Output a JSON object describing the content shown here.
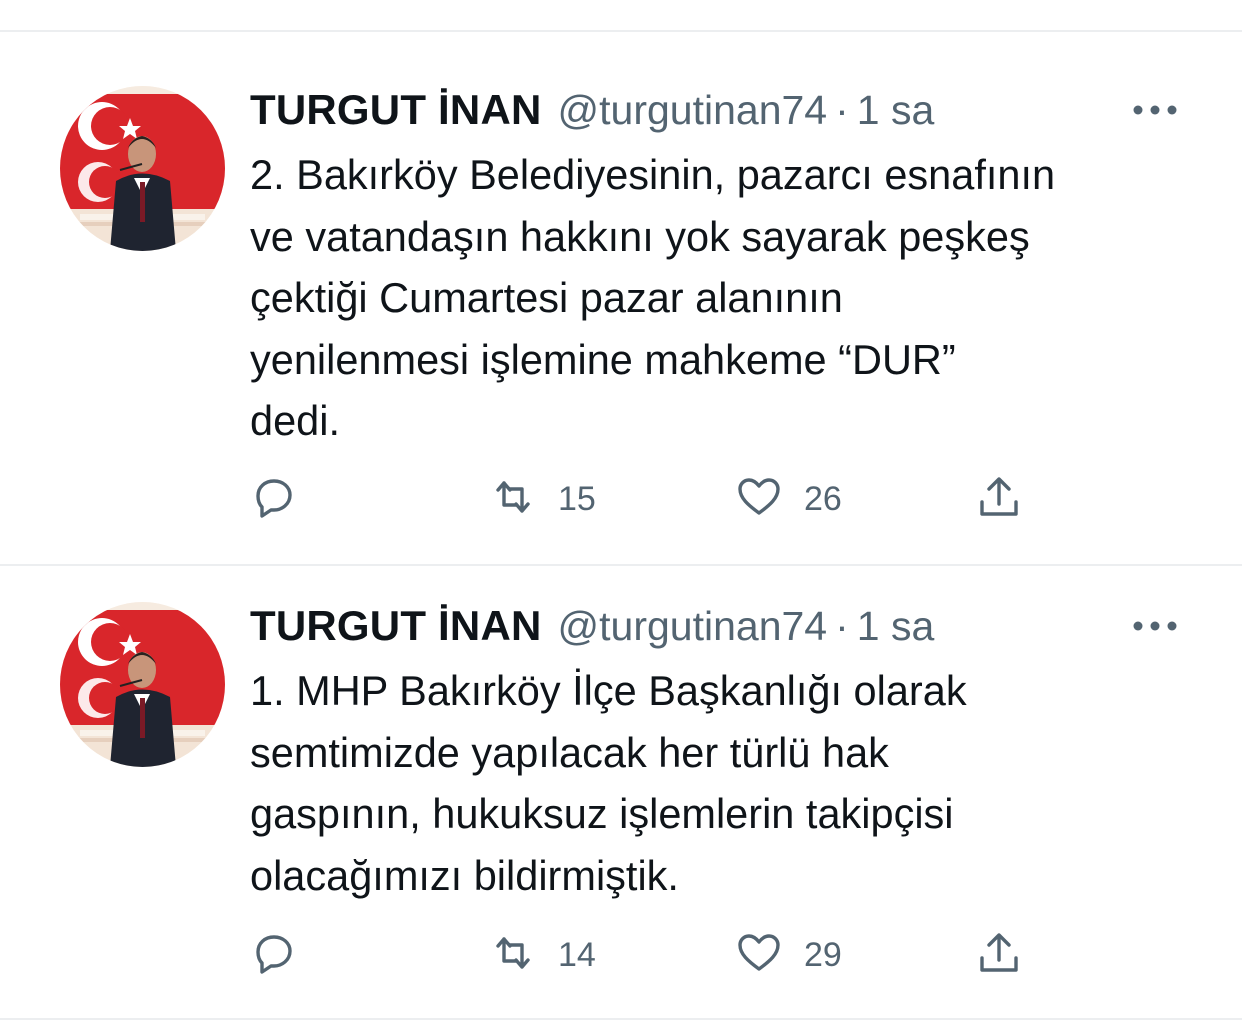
{
  "tweets": [
    {
      "author_name": "TURGUT İNAN",
      "handle": "@turgutinan74",
      "separator": "·",
      "time": "1 sa",
      "text": "2. Bakırköy Belediyesinin, pazarcı esnafının\nve vatandaşın hakkını yok sayarak peşkeş\nçektiği Cumartesi pazar alanının\nyenilenmesi işlemine mahkeme “DUR”\ndedi.",
      "reply_count": "",
      "retweet_count": "15",
      "like_count": "26",
      "icons": [
        "reply-icon",
        "retweet-icon",
        "like-icon",
        "share-icon",
        "more-icon"
      ]
    },
    {
      "author_name": "TURGUT İNAN",
      "handle": "@turgutinan74",
      "separator": "·",
      "time": "1 sa",
      "text": "1. MHP Bakırköy İlçe Başkanlığı olarak\nsemtimizde yapılacak her türlü hak\ngaspının, hukuksuz işlemlerin takipçisi\nolacağımızı bildirmiştik.",
      "reply_count": "",
      "retweet_count": "14",
      "like_count": "29",
      "icons": [
        "reply-icon",
        "retweet-icon",
        "like-icon",
        "share-icon",
        "more-icon"
      ]
    }
  ],
  "colors": {
    "text_primary": "#0f1419",
    "text_secondary": "#536471",
    "divider": "#eceef0",
    "flag_red": "#d9262b"
  }
}
